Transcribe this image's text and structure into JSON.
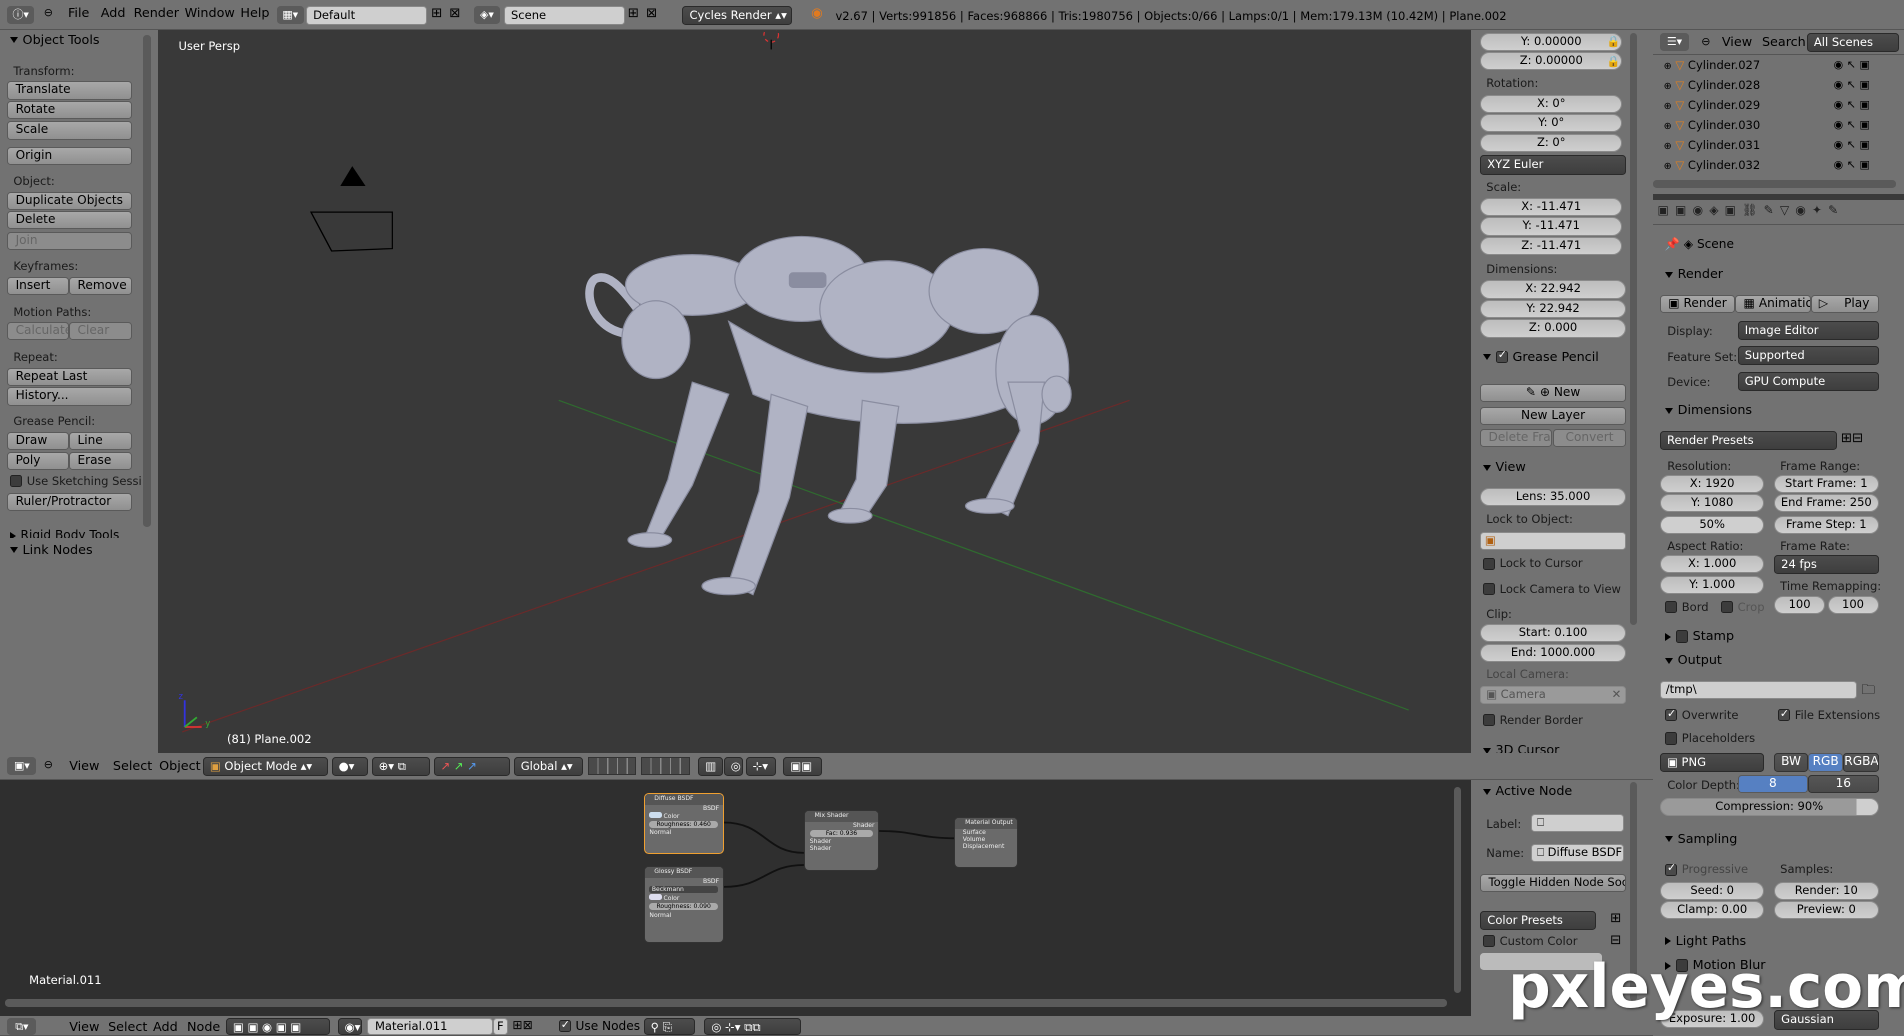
{
  "top_header": {
    "menus": [
      "File",
      "Add",
      "Render",
      "Window",
      "Help"
    ],
    "screen_layout": "Default",
    "scene": "Scene",
    "render_engine": "Cycles Render",
    "stats": "v2.67 | Verts:991856 | Faces:968866 | Tris:1980756 | Objects:0/66 | Lamps:0/1 | Mem:179.13M (10.42M) | Plane.002"
  },
  "tool_shelf": {
    "title": "Object Tools",
    "transform_label": "Transform:",
    "translate": "Translate",
    "rotate": "Rotate",
    "scale": "Scale",
    "origin": "Origin",
    "object_label": "Object:",
    "duplicate": "Duplicate Objects",
    "delete": "Delete",
    "join": "Join",
    "keyframes_label": "Keyframes:",
    "insert": "Insert",
    "remove": "Remove",
    "motion_label": "Motion Paths:",
    "calculate": "Calculate",
    "clear": "Clear",
    "repeat_label": "Repeat:",
    "repeat_last": "Repeat Last",
    "history": "History...",
    "grease_label": "Grease Pencil:",
    "draw": "Draw",
    "line": "Line",
    "poly": "Poly",
    "erase": "Erase",
    "use_sketching": "Use Sketching Sessi",
    "ruler": "Ruler/Protractor",
    "rigid_body": "Rigid Body Tools",
    "link_nodes": "Link Nodes"
  },
  "viewport": {
    "view_name": "User Persp",
    "object_info": "(81) Plane.002",
    "axis_x": "x",
    "axis_y": "y",
    "axis_z": "z"
  },
  "viewport_header": {
    "menus": [
      "View",
      "Select",
      "Object"
    ],
    "mode": "Object Mode",
    "orientation": "Global"
  },
  "properties_n": {
    "loc_y": "Y: 0.00000",
    "loc_z": "Z: 0.00000",
    "rotation_label": "Rotation:",
    "rot_x": "X: 0°",
    "rot_y": "Y: 0°",
    "rot_z": "Z: 0°",
    "rot_mode": "XYZ Euler",
    "scale_label": "Scale:",
    "scale_x": "X: -11.471",
    "scale_y": "Y: -11.471",
    "scale_z": "Z: -11.471",
    "dimensions_label": "Dimensions:",
    "dim_x": "X: 22.942",
    "dim_y": "Y: 22.942",
    "dim_z": "Z: 0.000",
    "grease_title": "Grease Pencil",
    "gp_new": "New",
    "gp_new_layer": "New Layer",
    "gp_delete_frame": "Delete Frame",
    "gp_convert": "Convert",
    "view_title": "View",
    "lens": "Lens: 35.000",
    "lock_object": "Lock to Object:",
    "lock_cursor": "Lock to Cursor",
    "lock_camera": "Lock Camera to View",
    "clip_label": "Clip:",
    "clip_start": "Start: 0.100",
    "clip_end": "End: 1000.000",
    "local_camera": "Local Camera:",
    "camera": "Camera",
    "render_border": "Render Border",
    "cursor_3d": "3D Cursor"
  },
  "outliner": {
    "menus": [
      "View",
      "Search"
    ],
    "filter": "All Scenes",
    "items": [
      "Cylinder.027",
      "Cylinder.028",
      "Cylinder.029",
      "Cylinder.030",
      "Cylinder.031",
      "Cylinder.032"
    ]
  },
  "render_props": {
    "scene": "Scene",
    "render_title": "Render",
    "render_btn": "Render",
    "animation_btn": "Animation",
    "play_btn": "Play",
    "display_label": "Display:",
    "display_val": "Image Editor",
    "feature_label": "Feature Set:",
    "feature_val": "Supported",
    "device_label": "Device:",
    "device_val": "GPU Compute",
    "dimensions_title": "Dimensions",
    "presets": "Render Presets",
    "resolution_label": "Resolution:",
    "res_x": "X: 1920",
    "res_y": "Y: 1080",
    "res_pct": "50%",
    "frame_range_label": "Frame Range:",
    "start_frame": "Start Frame: 1",
    "end_frame": "End Frame: 250",
    "frame_step": "Frame Step: 1",
    "aspect_label": "Aspect Ratio:",
    "aspect_x": "X: 1.000",
    "aspect_y": "Y: 1.000",
    "frame_rate_label": "Frame Rate:",
    "fps": "24 fps",
    "time_remap": "Time Remapping:",
    "remap_old": "100",
    "remap_new": "100",
    "bord": "Bord",
    "crop": "Crop",
    "stamp_title": "Stamp",
    "output_title": "Output",
    "output_path": "/tmp\\",
    "overwrite": "Overwrite",
    "file_ext": "File Extensions",
    "placeholders": "Placeholders",
    "format": "PNG",
    "bw": "BW",
    "rgb": "RGB",
    "rgba": "RGBA",
    "color_depth_label": "Color Depth:",
    "depth8": "8",
    "depth16": "16",
    "compression": "Compression: 90%",
    "sampling_title": "Sampling",
    "progressive": "Progressive",
    "samples_label": "Samples:",
    "seed": "Seed: 0",
    "render_samples": "Render: 10",
    "clamp": "Clamp: 0.00",
    "preview_samples": "Preview: 0",
    "light_paths": "Light Paths",
    "motion_blur": "Motion Blur",
    "exposure": "Exposure: 1.00",
    "filter": "Gaussian"
  },
  "node_editor": {
    "material_label": "Material.011",
    "menus": [
      "View",
      "Select",
      "Add",
      "Node"
    ],
    "material": "Material.011",
    "fake_user": "F",
    "use_nodes": "Use Nodes",
    "node_diffuse": "Diffuse BSDF",
    "node_glossy": "Glossy BSDF",
    "node_mix": "Mix Shader",
    "node_output": "Material Output",
    "diffuse_roughness": "Roughness: 0.460",
    "glossy_dist": "Beckmann",
    "glossy_roughness": "Roughness: 0.090",
    "mix_fac": "Fac: 0.936",
    "sock_color": "Color",
    "sock_normal": "Normal",
    "sock_bsdf": "BSDF",
    "sock_shader": "Shader",
    "sock_surface": "Surface",
    "sock_volume": "Volume",
    "sock_displacement": "Displacement"
  },
  "node_props": {
    "active_node_title": "Active Node",
    "label_label": "Label:",
    "name_label": "Name:",
    "name_val": "Diffuse BSDF",
    "toggle_hidden": "Toggle Hidden Node Sockets",
    "color_presets": "Color Presets",
    "custom_color": "Custom Color"
  },
  "watermark": "pxleyes.com",
  "colors": {
    "viewport_bg": "#393939",
    "panel_bg": "#727272",
    "node_bg": "#2f2f2f",
    "accent_blue": "#5680c2",
    "select_orange": "#f0a030"
  }
}
